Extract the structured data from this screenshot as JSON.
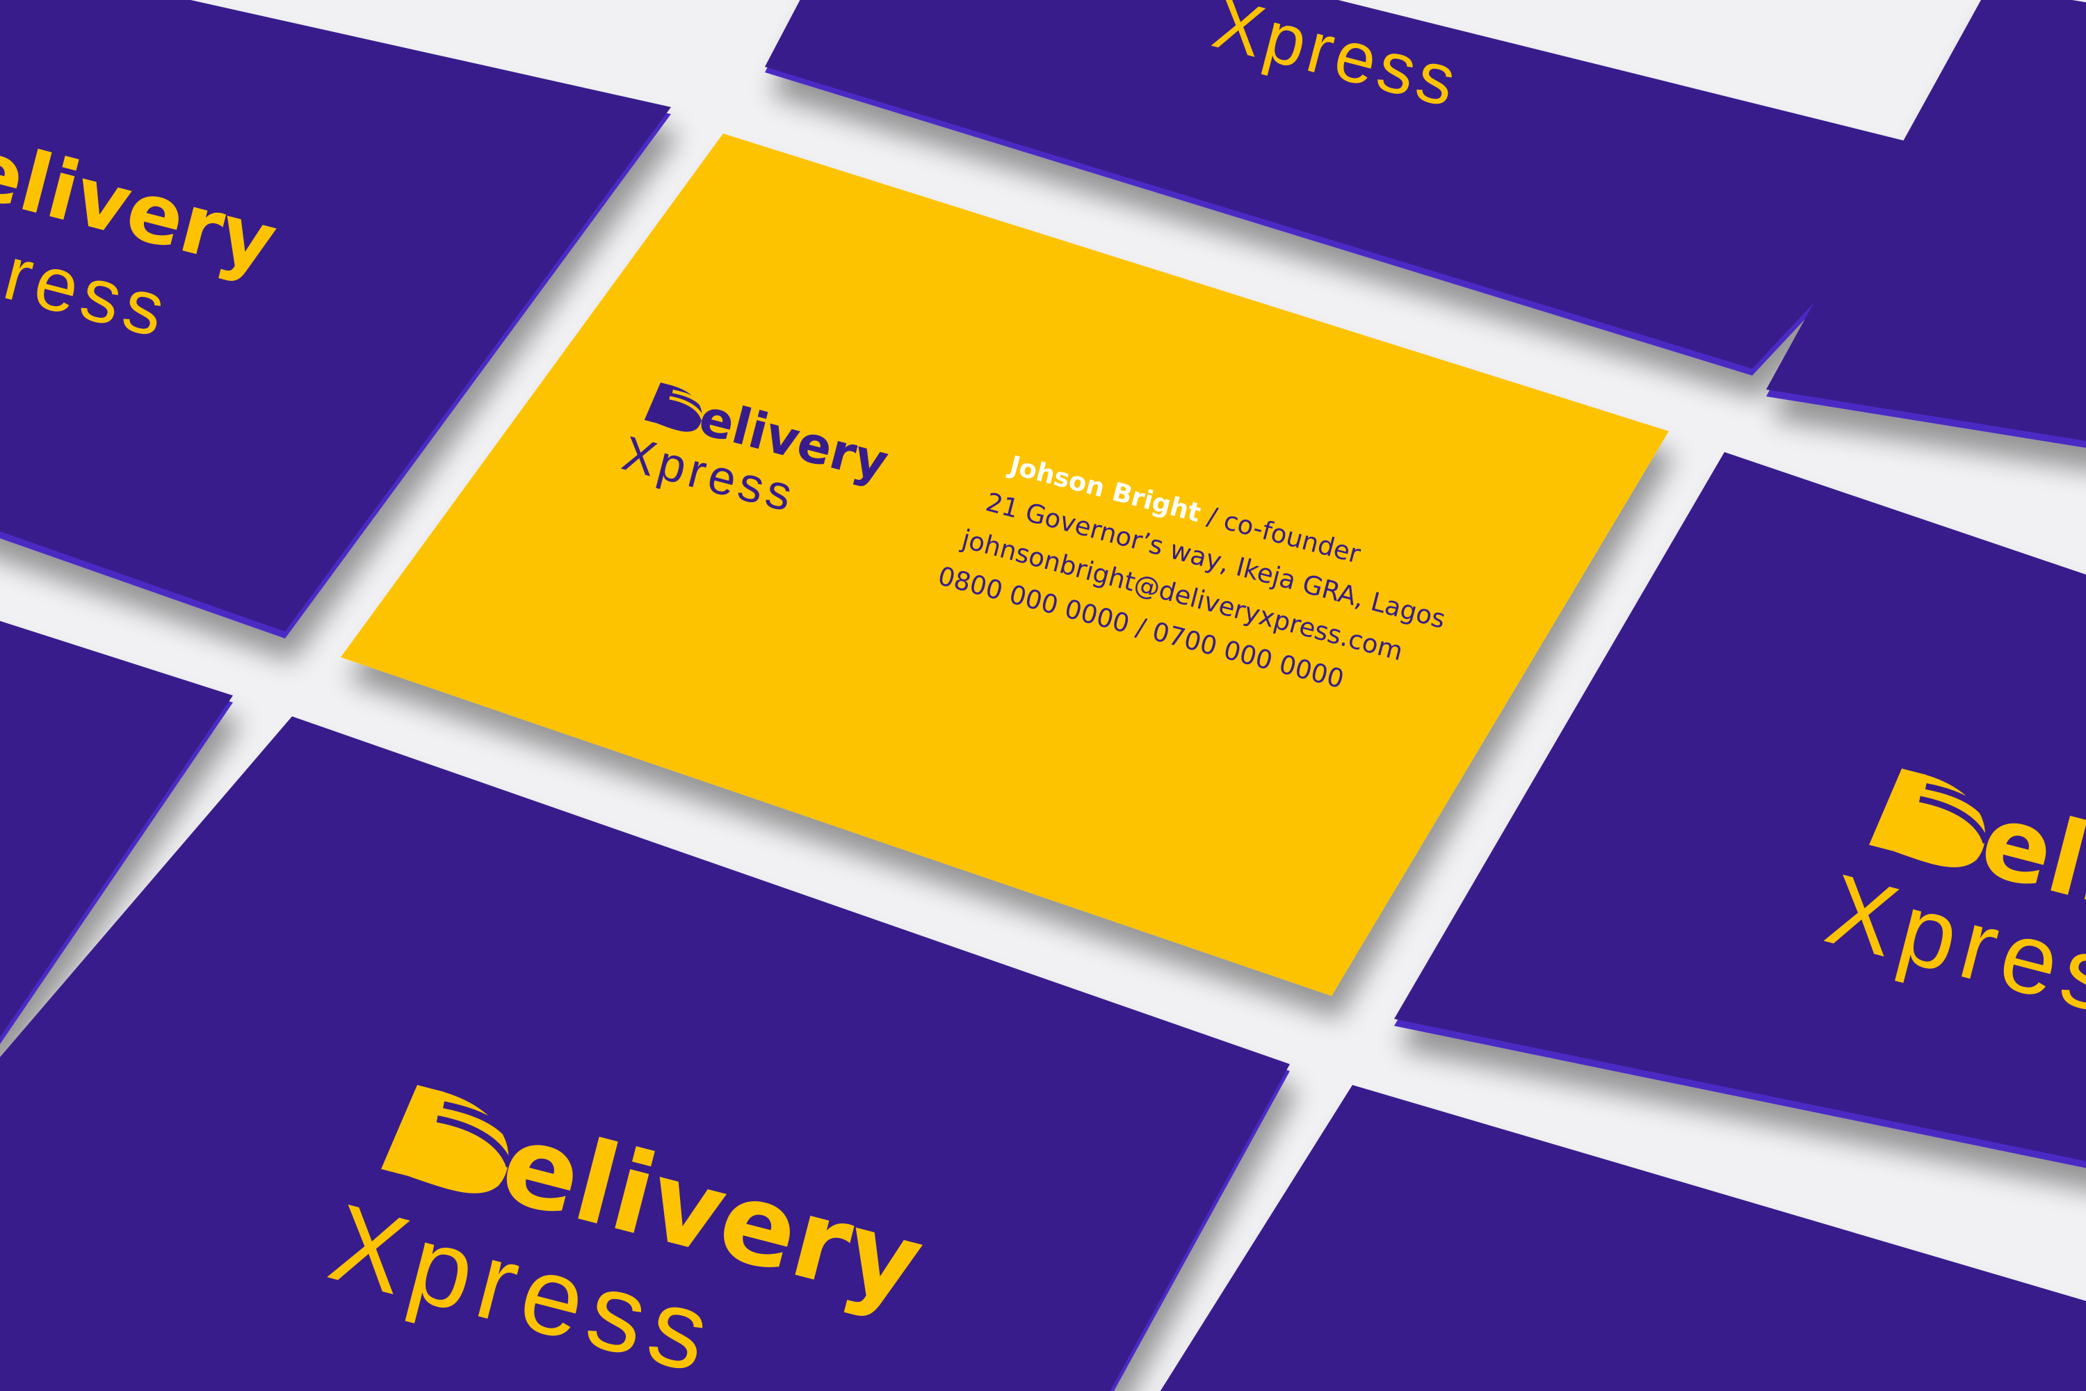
{
  "brand": {
    "word1": "elivery",
    "word2": "Xpress",
    "logo_note": "D"
  },
  "card": {
    "name": "Johson Bright",
    "role": " / co-founder",
    "address": "21 Governor’s way, Ikeja GRA, Lagos",
    "email": "johnsonbright@deliveryxpress.com",
    "phones": "0800 000 0000 / 0700 000 0000"
  },
  "colors": {
    "purple": "#381c8c",
    "purple_edge": "#4b2bc4",
    "yellow": "#fdc300",
    "background": "#f1f1f3",
    "white_text": "#ffffff"
  }
}
